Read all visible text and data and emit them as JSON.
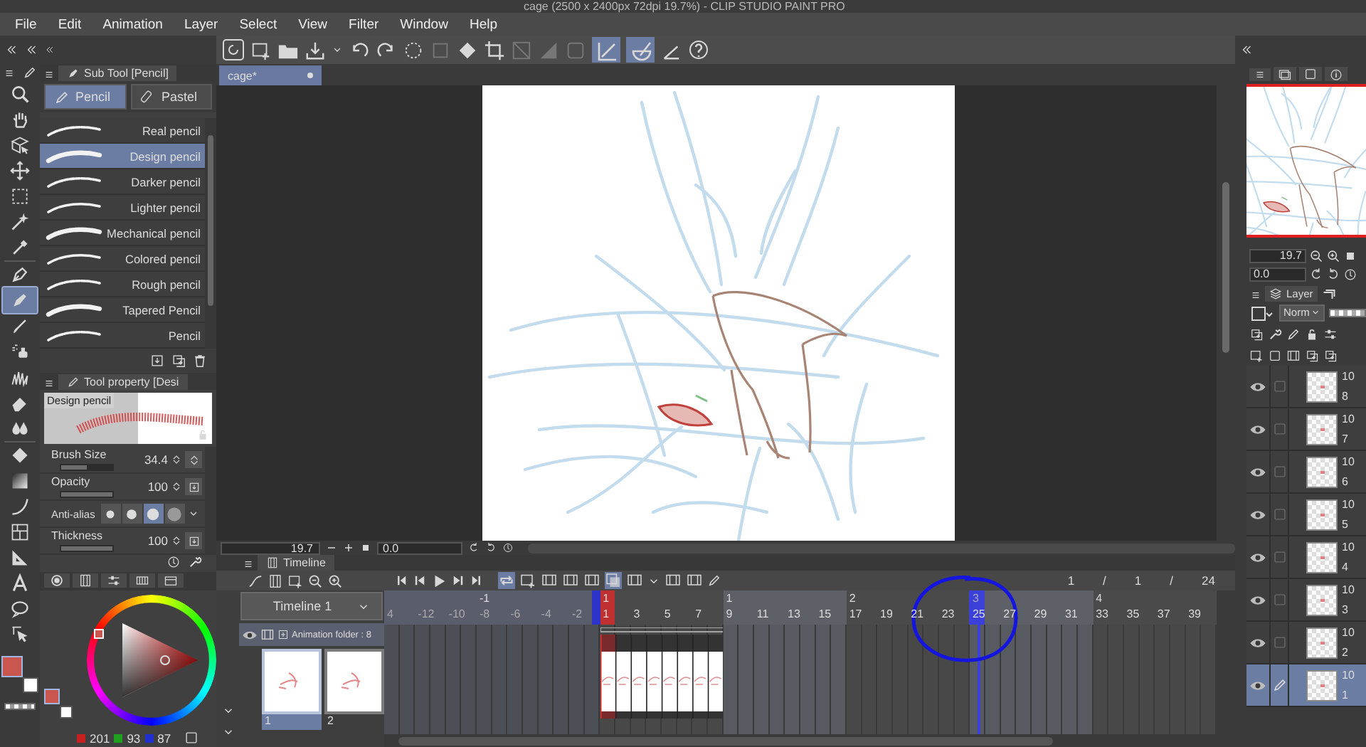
{
  "window": {
    "title": "cage  (2500 x 2400px 72dpi 19.7%)  - CLIP STUDIO PAINT PRO"
  },
  "menu": [
    "File",
    "Edit",
    "Animation",
    "Layer",
    "Select",
    "View",
    "Filter",
    "Window",
    "Help"
  ],
  "tools": [
    {
      "kind": "zoom",
      "selected": false
    },
    {
      "kind": "hand",
      "selected": false
    },
    {
      "kind": "operation",
      "selected": false
    },
    {
      "kind": "move",
      "selected": false
    },
    {
      "kind": "marquee",
      "selected": false
    },
    {
      "kind": "wand",
      "selected": false
    },
    {
      "kind": "eyedropper",
      "selected": false
    },
    {
      "kind": "pen",
      "selected": false
    },
    {
      "kind": "pencil",
      "selected": true
    },
    {
      "kind": "brush",
      "selected": false
    },
    {
      "kind": "airbrush",
      "selected": false
    },
    {
      "kind": "decoration",
      "selected": false
    },
    {
      "kind": "eraser",
      "selected": false
    },
    {
      "kind": "blend",
      "selected": false
    },
    {
      "kind": "fill",
      "selected": false
    },
    {
      "kind": "gradient",
      "selected": false
    },
    {
      "kind": "figure",
      "selected": false
    },
    {
      "kind": "frame",
      "selected": false
    },
    {
      "kind": "ruler",
      "selected": false
    },
    {
      "kind": "text",
      "selected": false
    },
    {
      "kind": "balloon",
      "selected": false
    },
    {
      "kind": "correct",
      "selected": false
    }
  ],
  "tool_colors": [
    {
      "color": "#c9574f",
      "selected": true
    },
    {
      "color": "#ffffff",
      "selected": false
    }
  ],
  "sub_tool": {
    "title": "Sub Tool [Pencil]",
    "tabs": [
      {
        "label": "Pencil",
        "selected": true
      },
      {
        "label": "Pastel",
        "selected": false
      }
    ],
    "brushes": [
      {
        "label": "Real pencil",
        "selected": false
      },
      {
        "label": "Design pencil",
        "selected": true
      },
      {
        "label": "Darker pencil",
        "selected": false
      },
      {
        "label": "Lighter pencil",
        "selected": false
      },
      {
        "label": "Mechanical pencil",
        "selected": false
      },
      {
        "label": "Colored pencil",
        "selected": false
      },
      {
        "label": "Rough pencil",
        "selected": false
      },
      {
        "label": "Tapered Pencil",
        "selected": false
      },
      {
        "label": "Pencil",
        "selected": false
      }
    ]
  },
  "tool_property": {
    "title": "Tool property [Desi",
    "preview_label": "Design pencil",
    "settings": [
      {
        "kind": "slider",
        "label": "Brush Size",
        "value": "34.4",
        "level": 0.5
      },
      {
        "kind": "slider",
        "label": "Opacity",
        "value": "100",
        "level": 1
      },
      {
        "kind": "options",
        "label": "Anti-alias",
        "options": [
          {
            "selected": false
          },
          {
            "selected": false
          },
          {
            "selected": true
          },
          {
            "selected": false
          }
        ]
      },
      {
        "kind": "slider",
        "label": "Thickness",
        "value": "100",
        "level": 1
      }
    ]
  },
  "color_panel": {
    "swatches": [
      {
        "color": "#c9574f",
        "selected": true
      },
      {
        "color": "#ffffff",
        "selected": false
      }
    ],
    "rgb": [
      "201",
      "93",
      "87"
    ]
  },
  "canvas": {
    "tab": "cage*",
    "zoom": "19.7",
    "angle": "0.0"
  },
  "timeline": {
    "title": "Timeline",
    "name": "Timeline 1",
    "counter": [
      "1",
      "/",
      "1",
      "/",
      "24"
    ],
    "track": {
      "label": "Animation folder : 8",
      "visible": true
    },
    "ruler": [
      {
        "label": "4",
        "kind": "frame"
      },
      {
        "label": "-12",
        "kind": "frame"
      },
      {
        "label": "-10",
        "kind": "frame"
      },
      {
        "label": "-8",
        "kind": "frame",
        "second": "-1"
      },
      {
        "label": "-6",
        "kind": "frame"
      },
      {
        "label": "-4",
        "kind": "frame"
      },
      {
        "label": "-2",
        "kind": "start"
      },
      {
        "label": "1",
        "kind": "current",
        "second": "1"
      },
      {
        "label": "3",
        "kind": "frame"
      },
      {
        "label": "5",
        "kind": "frame"
      },
      {
        "label": "7",
        "kind": "frame"
      },
      {
        "label": "9",
        "kind": "frame",
        "second": "1"
      },
      {
        "label": "11",
        "kind": "frame"
      },
      {
        "label": "13",
        "kind": "frame"
      },
      {
        "label": "15",
        "kind": "frame"
      },
      {
        "label": "17",
        "kind": "frame",
        "second": "2"
      },
      {
        "label": "19",
        "kind": "frame"
      },
      {
        "label": "21",
        "kind": "frame"
      },
      {
        "label": "23",
        "kind": "frame"
      },
      {
        "label": "25",
        "kind": "playhead",
        "second": "3"
      },
      {
        "label": "27",
        "kind": "frame"
      },
      {
        "label": "29",
        "kind": "frame"
      },
      {
        "label": "31",
        "kind": "frame"
      },
      {
        "label": "33",
        "kind": "frame",
        "second": "4"
      },
      {
        "label": "35",
        "kind": "frame"
      },
      {
        "label": "37",
        "kind": "frame"
      },
      {
        "label": "39",
        "kind": "frame"
      }
    ],
    "thumbnails": [
      {
        "label": "1",
        "selected": true
      },
      {
        "label": "2",
        "selected": false
      }
    ]
  },
  "navigator": {
    "zoom": "19.7",
    "angle": "0.0"
  },
  "layers": {
    "title": "Layer",
    "blend_mode": "Norm",
    "opacity_slider": {
      "level": 1
    },
    "items": [
      {
        "opacity": "10",
        "name": "8",
        "visible": true,
        "selected": false
      },
      {
        "opacity": "10",
        "name": "7",
        "visible": true,
        "selected": false
      },
      {
        "opacity": "10",
        "name": "6",
        "visible": true,
        "selected": false
      },
      {
        "opacity": "10",
        "name": "5",
        "visible": true,
        "selected": false
      },
      {
        "opacity": "10",
        "name": "4",
        "visible": true,
        "selected": false
      },
      {
        "opacity": "10",
        "name": "3",
        "visible": true,
        "selected": false
      },
      {
        "opacity": "10",
        "name": "2",
        "visible": true,
        "selected": false
      },
      {
        "opacity": "10",
        "name": "1",
        "visible": true,
        "selected": true
      }
    ]
  }
}
